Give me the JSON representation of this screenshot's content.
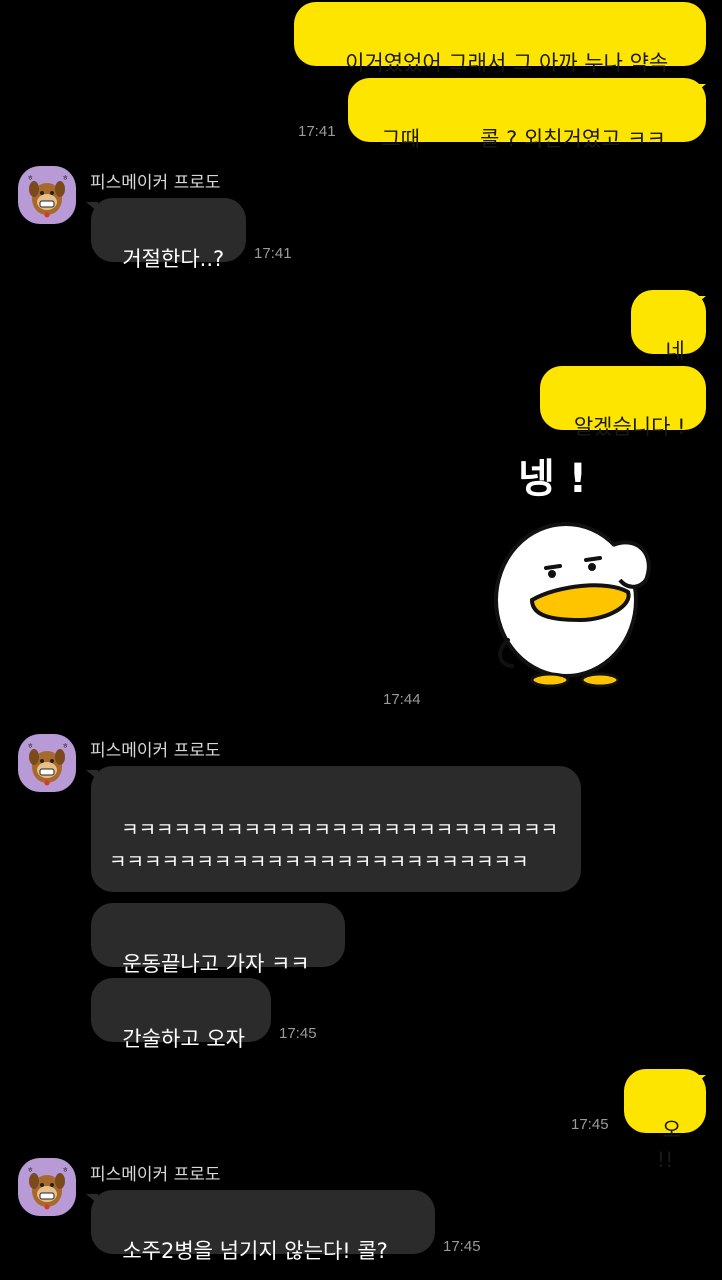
{
  "colors": {
    "background": "#000000",
    "my_bubble": "#FEE500",
    "their_bubble": "#2b2b2b",
    "avatar_bg": "#b89ad6",
    "timestamp": "#9a9a9a"
  },
  "messages": {
    "m1": {
      "text": "이거였었어 그래서 그 아까 누나 약속"
    },
    "m2": {
      "text": "그때         콜 ? 외친거였고 ㅋㅋ",
      "time": "17:41"
    },
    "m3": {
      "sender": "피스메이커 프로도",
      "text": "거절한다..?",
      "time": "17:41"
    },
    "m4": {
      "text": "네 !"
    },
    "m5": {
      "text": "알겠습니다 !"
    },
    "sticker": {
      "caption": "넹 !",
      "icon": "duck-sticker-icon",
      "time": "17:44"
    },
    "m6": {
      "sender": "피스메이커 프로도",
      "text": "ㅋㅋㅋㅋㅋㅋㅋㅋㅋㅋㅋㅋㅋㅋㅋㅋㅋㅋㅋㅋㅋㅋㅋㅋㅋㅋㅋㅋㅋㅋㅋㅋㅋㅋㅋㅋㅋㅋㅋㅋㅋㅋㅋㅋㅋㅋㅋㅋㅋ"
    },
    "m7": {
      "text": "운동끝나고 가자 ㅋㅋ"
    },
    "m8": {
      "text": "간술하고 오자",
      "time": "17:45"
    },
    "m9": {
      "text": "오 !!",
      "time": "17:45"
    },
    "m10": {
      "sender": "피스메이커 프로도",
      "text": "소주2병을 넘기지 않는다! 콜?",
      "time": "17:45"
    }
  }
}
